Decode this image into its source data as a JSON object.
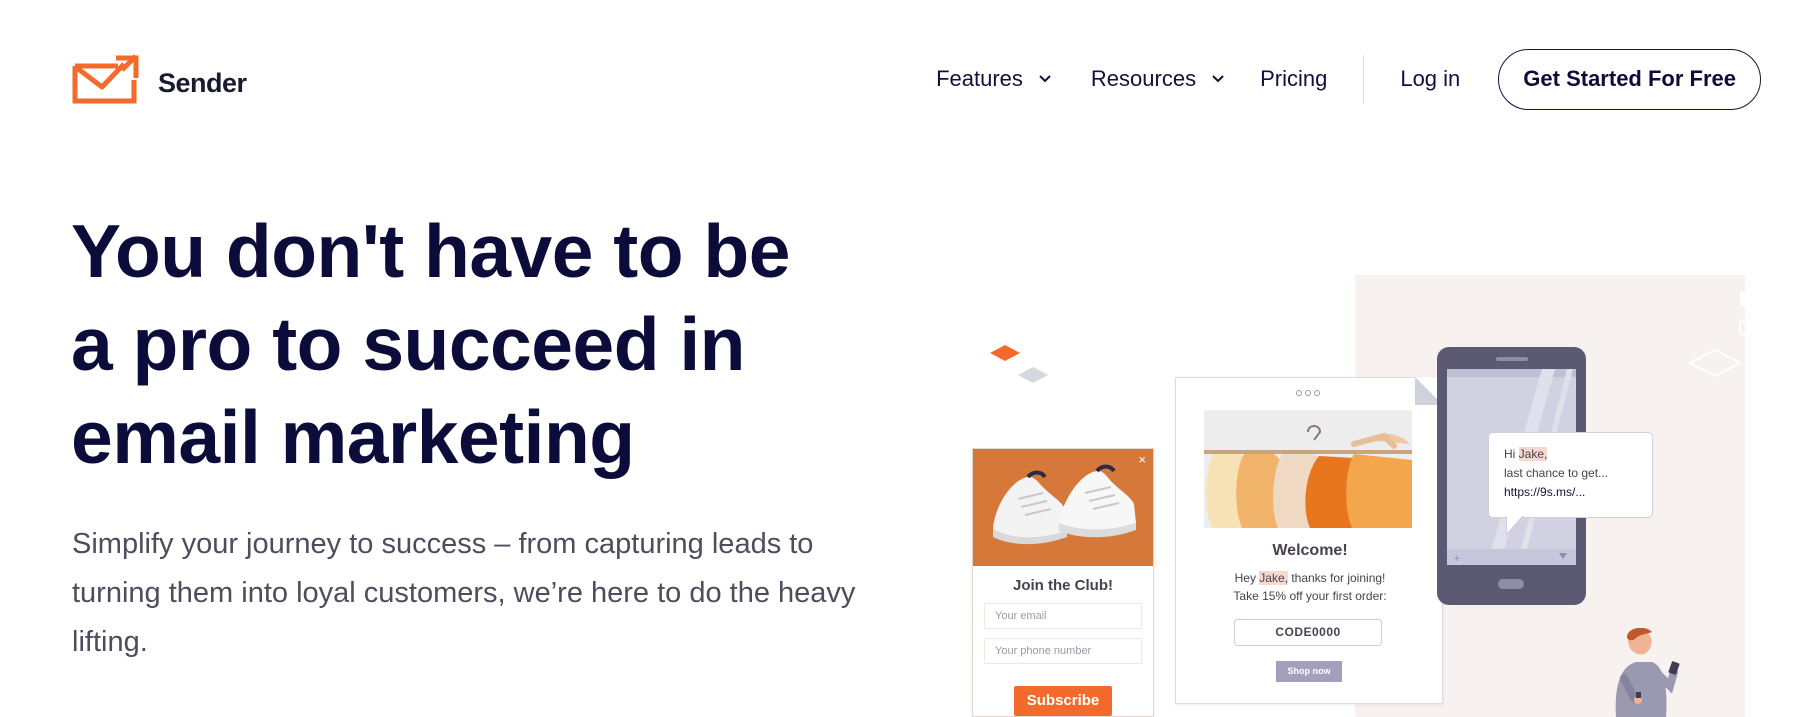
{
  "header": {
    "brand": "Sender",
    "nav": {
      "features": "Features",
      "resources": "Resources",
      "pricing": "Pricing",
      "login": "Log in",
      "cta": "Get Started For Free"
    }
  },
  "hero": {
    "title_line1": "You don't have to be",
    "title_line2": "a pro to succeed in",
    "title_line3": "email marketing",
    "subtitle_line1": "Simplify your journey to success – from capturing leads to",
    "subtitle_line2": "turning them into loyal customers, we’re here to do the heavy",
    "subtitle_line3": "lifting."
  },
  "illustration": {
    "popup": {
      "close": "×",
      "title": "Join the Club!",
      "email_placeholder": "Your email",
      "phone_placeholder": "Your phone number",
      "button": "Subscribe"
    },
    "email": {
      "title": "Welcome!",
      "line1_prefix": "Hey ",
      "line1_name": "Jake,",
      "line1_suffix": " thanks for joining!",
      "line2": "Take 15% off your first order:",
      "code": "CODE0000",
      "button": "Shop now"
    },
    "sms": {
      "greeting_prefix": "Hi ",
      "greeting_name": "Jake,",
      "line2": "last chance to get...",
      "link": "https://9s.ms/..."
    }
  },
  "colors": {
    "brand_orange": "#f26b2d",
    "navy": "#0c0c3a",
    "panel_bg": "#f7f2f0"
  }
}
